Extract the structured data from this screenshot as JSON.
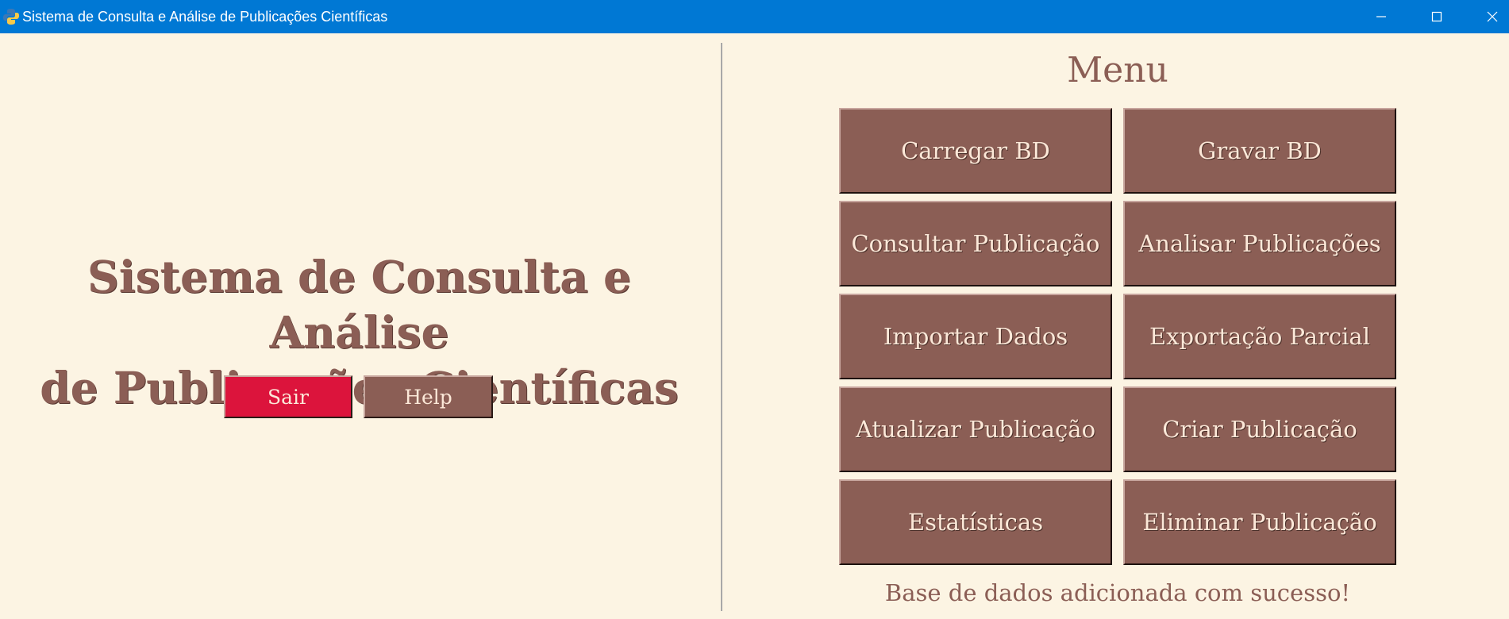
{
  "window": {
    "title": "Sistema de Consulta e Análise de Publicações Científicas",
    "icon": "python-icon",
    "controls": [
      "minimize-icon",
      "maximize-icon",
      "close-icon"
    ]
  },
  "left_panel": {
    "title_line1": "Sistema de Consulta e Análise",
    "title_line2": "de Publicações Científicas",
    "exit_label": "Sair",
    "help_label": "Help"
  },
  "menu": {
    "title": "Menu",
    "buttons": [
      {
        "label": "Carregar BD"
      },
      {
        "label": "Gravar BD"
      },
      {
        "label": "Consultar Publicação"
      },
      {
        "label": "Analisar Publicações"
      },
      {
        "label": "Importar Dados"
      },
      {
        "label": "Exportação Parcial"
      },
      {
        "label": "Atualizar Publicação"
      },
      {
        "label": "Criar Publicação"
      },
      {
        "label": "Estatísticas"
      },
      {
        "label": "Eliminar Publicação"
      }
    ],
    "status": "Base de dados adicionada com sucesso!"
  },
  "colors": {
    "titlebar": "#0078d4",
    "background": "#fcf4e3",
    "accent": "#8b5e55",
    "exit_button": "#dc143c",
    "button_text": "#fce8d8"
  }
}
